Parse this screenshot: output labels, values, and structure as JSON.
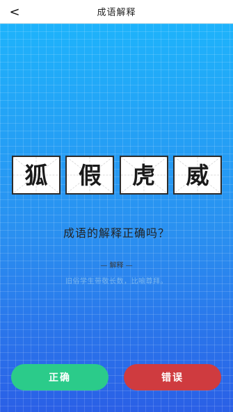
{
  "header": {
    "back_glyph": "<",
    "title": "成语解释"
  },
  "idiom": {
    "characters": [
      "狐",
      "假",
      "虎",
      "威"
    ]
  },
  "question": "成语的解释正确吗？",
  "explanation": {
    "section_title": "— 解释 —",
    "text": "旧俗学生带敬长数，比喻尊拜。"
  },
  "buttons": {
    "correct_label": "正确",
    "wrong_label": "错误"
  },
  "colors": {
    "background_top": "#1eb3fb",
    "background_bottom": "#2a5fe6",
    "correct_button": "#2bcb8a",
    "wrong_button": "#cf3b3f"
  }
}
